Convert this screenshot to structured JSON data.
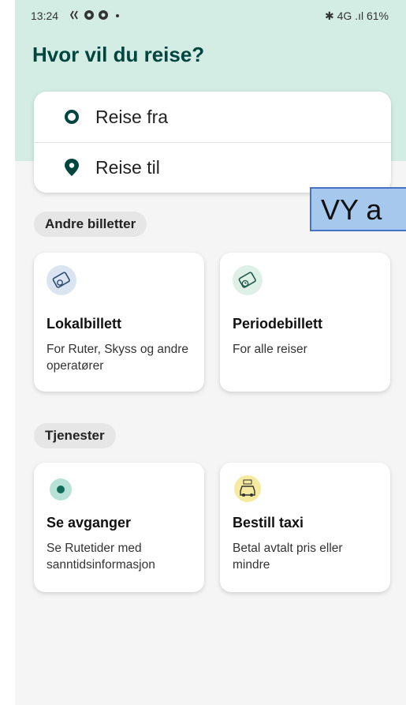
{
  "status_bar": {
    "time": "13:24",
    "icons_left": "✨ ● ● •",
    "right": "✱ 4G .ıl 61%"
  },
  "page": {
    "title": "Hvor vil du reise?"
  },
  "search": {
    "from_label": "Reise fra",
    "to_label": "Reise til"
  },
  "sections": {
    "other_tickets": "Andre billetter",
    "services": "Tjenester"
  },
  "tiles": [
    {
      "title": "Lokalbillett",
      "desc": "For Ruter, Skyss og andre operatører",
      "icon": "ticket-icon"
    },
    {
      "title": "Periodebillett",
      "desc": "For alle reiser",
      "icon": "period-ticket-icon"
    },
    {
      "title": "Se avganger",
      "desc": "Se Rutetider med sanntidsinformasjon",
      "icon": "departures-dot-icon"
    },
    {
      "title": "Bestill taxi",
      "desc": "Betal avtalt pris eller mindre",
      "icon": "taxi-icon"
    }
  ],
  "overlay": {
    "text": "VY a"
  },
  "colors": {
    "brand_dark": "#00453e",
    "header_mint": "#d3ece4",
    "teal_dot": "#0f7a68",
    "chip_bg": "#e6e6e6"
  }
}
